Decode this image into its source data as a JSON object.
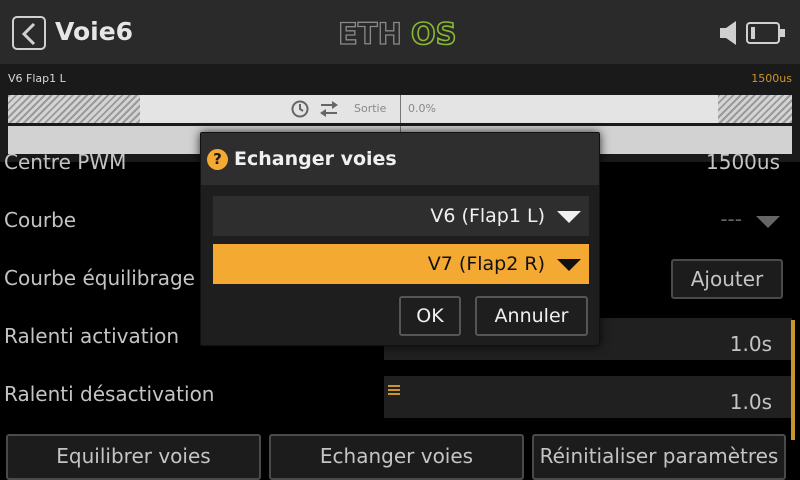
{
  "header": {
    "title": "Voie6",
    "logo_text": "ETHOS",
    "logo_colors": {
      "ETH": "#7a7a7a",
      "OS": "#8ab832"
    }
  },
  "monitor": {
    "channel_name": "V6  Flap1 L",
    "channel_value": "1500us",
    "output_label": "Sortie",
    "output_value": "0.0%"
  },
  "settings": {
    "pwm_center": {
      "label": "Centre PWM",
      "value": "1500us"
    },
    "curve": {
      "label": "Courbe",
      "value": "---"
    },
    "balance_curve": {
      "label": "Courbe équilibrage",
      "button": "Ajouter"
    },
    "slow_up": {
      "label": "Ralenti activation",
      "value": "1.0s"
    },
    "slow_down": {
      "label": "Ralenti désactivation",
      "value": "1.0s"
    }
  },
  "bottom_buttons": [
    "Equilibrer voies",
    "Echanger voies",
    "Réinitialiser paramètres"
  ],
  "dialog": {
    "title": "Echanger voies",
    "help_glyph": "?",
    "source": "V6 (Flap1 L)",
    "target": "V7 (Flap2 R)",
    "ok_label": "OK",
    "cancel_label": "Annuler"
  },
  "colors": {
    "accent": "#f4a933",
    "value_accent": "#c8962c"
  }
}
